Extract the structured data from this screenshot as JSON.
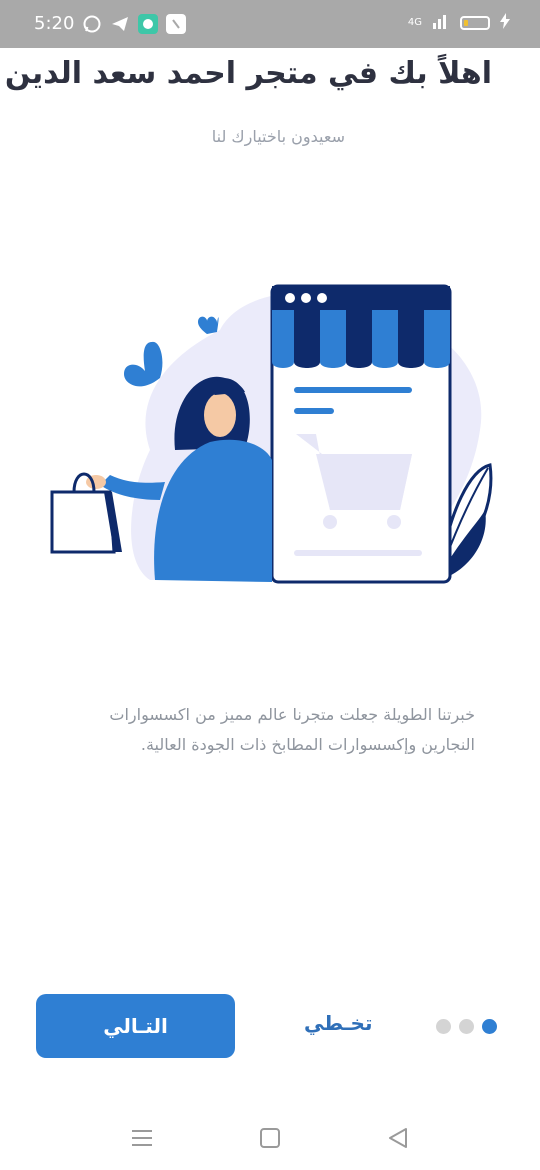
{
  "status": {
    "time": "5:20",
    "network": "4G",
    "battery_level": 0.2,
    "icons": [
      "whatsapp-icon",
      "telegram-icon",
      "messenger-icon",
      "sim-icon",
      "signal-icon",
      "battery-icon"
    ]
  },
  "onboarding": {
    "title": "اهلاً بك في متجر احمد سعد الدين",
    "subtitle": "سعيدون باختيارك لنا",
    "description": "خبرتنا الطويلة جعلت متجرنا عالم مميز من اكسسوارات النجارين وإكسسوارات المطابخ ذات الجودة العالية.",
    "next_label": "التـالي",
    "skip_label": "تخـطي",
    "page_count": 3,
    "current_page": 1
  },
  "colors": {
    "accent": "#2f7fd3",
    "navy": "#0e2a6b",
    "text_dark": "#2e3140",
    "text_muted": "#8f959e",
    "status_bar": "#a9a9a9"
  }
}
